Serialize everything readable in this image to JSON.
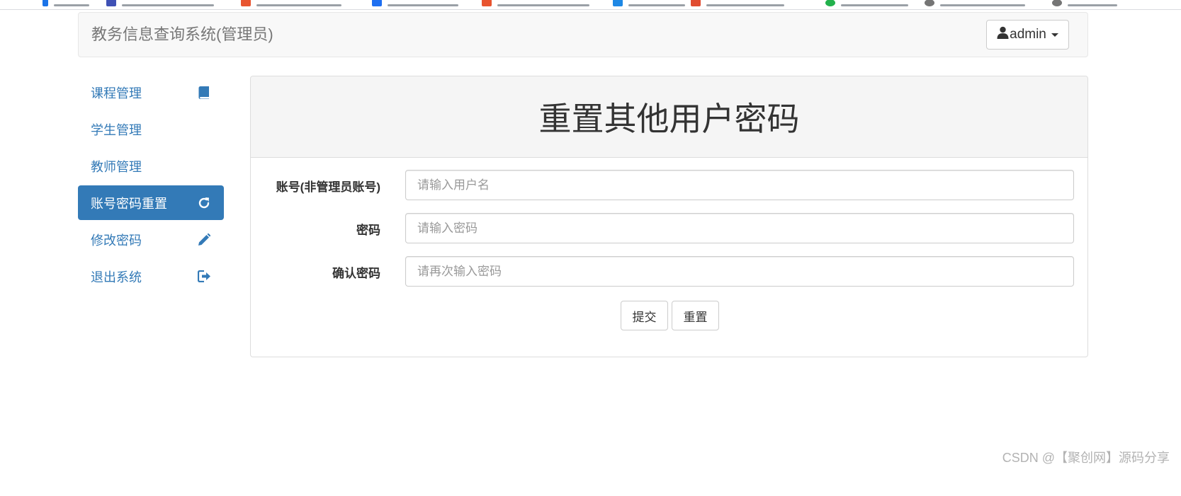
{
  "navbar": {
    "brand": "教务信息查询系统(管理员)",
    "user_label": "admin"
  },
  "sidebar": {
    "items": [
      {
        "label": "课程管理",
        "icon": "book-icon"
      },
      {
        "label": "学生管理",
        "icon": ""
      },
      {
        "label": "教师管理",
        "icon": ""
      },
      {
        "label": "账号密码重置",
        "icon": "refresh-icon",
        "active": true
      },
      {
        "label": "修改密码",
        "icon": "pencil-icon"
      },
      {
        "label": "退出系统",
        "icon": "logout-icon"
      }
    ]
  },
  "panel": {
    "title": "重置其他用户密码",
    "fields": [
      {
        "label": "账号(非管理员账号)",
        "placeholder": "请输入用户名",
        "value": ""
      },
      {
        "label": "密码",
        "placeholder": "请输入密码",
        "value": ""
      },
      {
        "label": "确认密码",
        "placeholder": "请再次输入密码",
        "value": ""
      }
    ],
    "submit_label": "提交",
    "reset_label": "重置"
  },
  "watermark": "CSDN @【聚创网】源码分享",
  "colors": {
    "primary": "#337ab7",
    "navbar_bg": "#f8f8f8",
    "panel_heading_bg": "#f5f5f5",
    "brand_text": "#777777"
  }
}
